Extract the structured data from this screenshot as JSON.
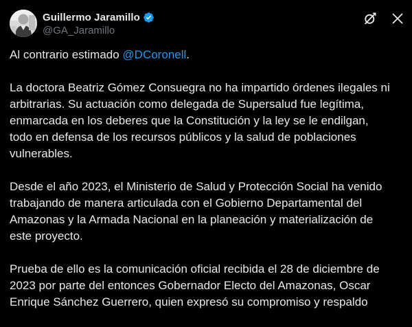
{
  "author": {
    "display_name": "Guillermo Jaramillo",
    "handle": "@GA_Jaramillo",
    "verified": true,
    "verified_color": "#1d9bf0"
  },
  "icons": {
    "avatar": "avatar-photo",
    "grok": "grok-icon",
    "more": "close-x-icon"
  },
  "tweet": {
    "p1_prefix": "Al contrario estimado ",
    "p1_mention": "@DCoronell",
    "p1_suffix": ".",
    "lines": [
      "La doctora Beatriz Gómez Consuegra no ha impartido órdenes ilegales ni",
      "arbitrarias. Su actuación como delegada de Supersalud fue legítima,",
      "enmarcada en los deberes que la Constitución y la ley se le endilgan,",
      "todo en defensa de los recursos públicos y la salud de poblaciones",
      "vulnerables.",
      "Desde el año 2023, el Ministerio de Salud y Protección Social ha venido",
      "trabajando de manera articulada con el Gobierno Departamental del",
      "Amazonas y la Armada Nacional en la planeación y materialización de",
      "este proyecto.",
      "Prueba de ello es la comunicación oficial recibida el 28 de diciembre de",
      "2023 por parte del entonces Gobernador Electo del Amazonas, Oscar",
      "Enrique Sánchez Guerrero, quien expresó su compromiso y respaldo"
    ]
  },
  "colors": {
    "background": "#000000",
    "text": "#e7e9ea",
    "secondary": "#71767b",
    "link": "#1d9bf0"
  }
}
